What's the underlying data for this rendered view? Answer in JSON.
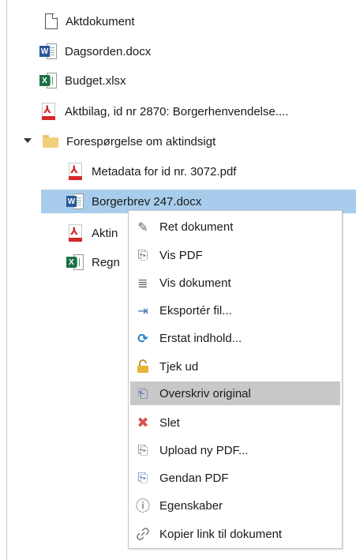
{
  "tree": {
    "items": [
      {
        "label": "Aktdokument",
        "icon": "document-icon"
      },
      {
        "label": "Dagsorden.docx",
        "icon": "word-icon"
      },
      {
        "label": "Budget.xlsx",
        "icon": "excel-icon"
      },
      {
        "label": "Aktbilag, id nr 2870: Borgerhenvendelse....",
        "icon": "pdf-icon"
      },
      {
        "label": "Forespørgelse om aktindsigt",
        "icon": "folder-icon",
        "expanded": true
      },
      {
        "label": "Metadata for id nr. 3072.pdf",
        "icon": "pdf-icon"
      },
      {
        "label": "Borgerbrev 247.docx",
        "icon": "word-icon",
        "selected": true
      },
      {
        "label": "Aktin",
        "icon": "pdf-icon"
      },
      {
        "label": "Regn",
        "icon": "excel-icon"
      }
    ],
    "word_badge": "W",
    "excel_badge": "X"
  },
  "context_menu": {
    "items": [
      {
        "label": "Ret dokument",
        "icon": "edit-document-icon",
        "glyph": "✎"
      },
      {
        "label": "Vis PDF",
        "icon": "pdf-outline-icon",
        "glyph": "⎘"
      },
      {
        "label": "Vis dokument",
        "icon": "view-document-icon",
        "glyph": "≣"
      },
      {
        "label": "Eksportér fil...",
        "icon": "export-file-icon",
        "glyph": "⇥"
      },
      {
        "label": "Erstat indhold...",
        "icon": "refresh-icon",
        "glyph": "⟳"
      },
      {
        "label": "Tjek ud",
        "icon": "lock-icon",
        "glyph": "🔓"
      },
      {
        "label": "Overskriv original",
        "icon": "overwrite-icon",
        "glyph": "⎗",
        "highlighted": true
      },
      {
        "label": "Slet",
        "icon": "delete-icon",
        "glyph": "✖"
      },
      {
        "label": "Upload ny PDF...",
        "icon": "upload-pdf-icon",
        "glyph": "⎘"
      },
      {
        "label": "Gendan PDF",
        "icon": "restore-pdf-icon",
        "glyph": "⎘"
      },
      {
        "label": "Egenskaber",
        "icon": "info-icon",
        "glyph": "ⓘ"
      },
      {
        "label": "Kopier link til dokument",
        "icon": "link-icon",
        "glyph": "🔗"
      }
    ]
  },
  "colors": {
    "selection": "#a8cdec",
    "menu_highlight": "#c8c8c8",
    "pdf_red": "#d4282b",
    "word_blue": "#2b5797",
    "excel_green": "#1e7145",
    "folder_yellow": "#f2cf7d",
    "refresh_blue": "#1e7cc4",
    "lock_gold": "#e0a82e",
    "delete_red": "#d9534f"
  }
}
